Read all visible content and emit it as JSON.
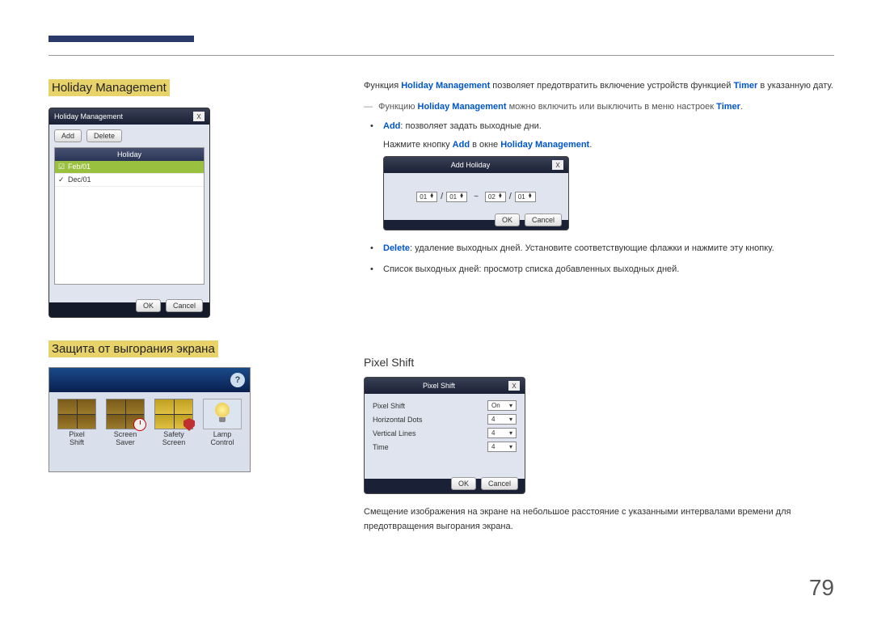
{
  "page_number": "79",
  "headings": {
    "holiday_management": "Holiday Management",
    "screen_burn": "Защита от выгорания экрана",
    "pixel_shift": "Pixel Shift"
  },
  "hm_shot": {
    "title": "Holiday Management",
    "add": "Add",
    "delete": "Delete",
    "col": "Holiday",
    "rows": [
      "Feb/01",
      "Dec/01"
    ],
    "ok": "OK",
    "cancel": "Cancel"
  },
  "burn_icons": {
    "pixel_shift": "Pixel\nShift",
    "screen_saver": "Screen\nSaver",
    "safety_screen": "Safety\nScreen",
    "lamp_control": "Lamp\nControl"
  },
  "right": {
    "p1_a": "Функция ",
    "p1_b": "Holiday Management",
    "p1_c": " позволяет предотвратить включение устройств функцией ",
    "p1_d": "Timer",
    "p1_e": " в указанную дату.",
    "note_a": "Функцию ",
    "note_b": "Holiday Management",
    "note_c": " можно включить или выключить в меню настроек ",
    "note_d": "Timer",
    "note_e": ".",
    "b1_a": "Add",
    "b1_b": ": позволяет задать выходные дни.",
    "b1_sub_a": "Нажмите кнопку ",
    "b1_sub_b": "Add",
    "b1_sub_c": " в окне ",
    "b1_sub_d": "Holiday Management",
    "b1_sub_e": ".",
    "b2_a": "Delete",
    "b2_b": ": удаление выходных дней. Установите соответствующие флажки и нажмите эту кнопку.",
    "b3": "Список выходных дней: просмотр списка добавленных выходных дней.",
    "ps_desc": "Смещение изображения на экране на небольшое расстояние с указанными интервалами времени для предотвращения выгорания экрана."
  },
  "add_shot": {
    "title": "Add Holiday",
    "m1": "01",
    "d1": "01",
    "m2": "02",
    "d2": "01",
    "ok": "OK",
    "cancel": "Cancel"
  },
  "ps_shot": {
    "title": "Pixel Shift",
    "r1_l": "Pixel Shift",
    "r1_v": "On",
    "r2_l": "Horizontal Dots",
    "r2_v": "4",
    "r3_l": "Vertical Lines",
    "r3_v": "4",
    "r4_l": "Time",
    "r4_v": "4",
    "ok": "OK",
    "cancel": "Cancel"
  }
}
